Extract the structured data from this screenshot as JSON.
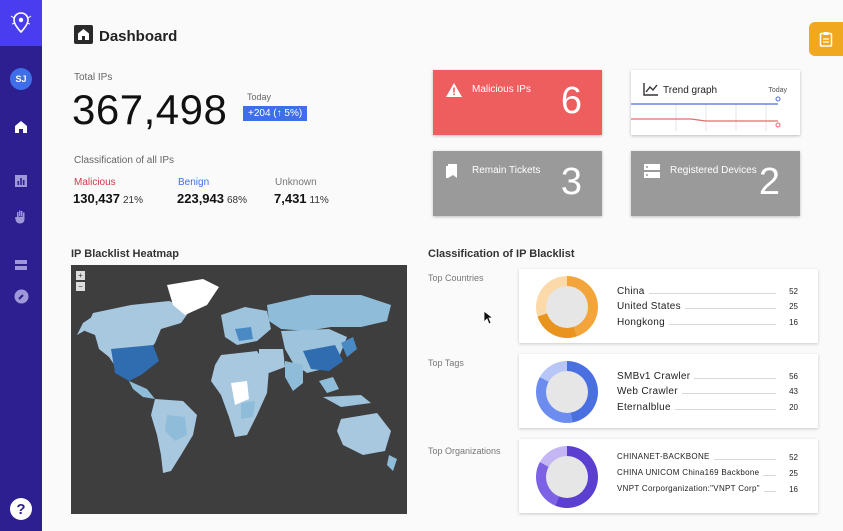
{
  "header": {
    "title": "Dashboard"
  },
  "user": {
    "initials": "SJ"
  },
  "total": {
    "label": "Total IPs",
    "value": "367,498",
    "today_label": "Today",
    "delta": "+204 (↑ 5%)"
  },
  "classification": {
    "title": "Classification of all IPs",
    "items": [
      {
        "name": "Malicious",
        "value": "130,437",
        "pct": "21%",
        "color": "#d9374b"
      },
      {
        "name": "Benign",
        "value": "223,943",
        "pct": "68%",
        "color": "#3f6fe8"
      },
      {
        "name": "Unknown",
        "value": "7,431",
        "pct": "11%",
        "color": "#777777"
      }
    ]
  },
  "cards": {
    "malicious": {
      "label": "Malicious IPs",
      "value": "6"
    },
    "trend": {
      "label": "Trend graph",
      "today": "Today"
    },
    "tickets": {
      "label": "Remain Tickets",
      "value": "3"
    },
    "devices": {
      "label": "Registered Devices",
      "value": "2"
    }
  },
  "heatmap": {
    "title": "IP Blacklist Heatmap",
    "zoom_in": "+",
    "zoom_out": "−"
  },
  "blacklist": {
    "title": "Classification of IP Blacklist",
    "countries": {
      "label": "Top Countries",
      "rows": [
        {
          "name": "China",
          "value": "52"
        },
        {
          "name": "United States",
          "value": "25"
        },
        {
          "name": "Hongkong",
          "value": "16"
        }
      ]
    },
    "tags": {
      "label": "Top Tags",
      "rows": [
        {
          "name": "SMBv1 Crawler",
          "value": "56"
        },
        {
          "name": "Web Crawler",
          "value": "43"
        },
        {
          "name": "Eternalblue",
          "value": "20"
        }
      ]
    },
    "orgs": {
      "label": "Top Organizations",
      "rows": [
        {
          "name": "CHINANET-BACKBONE",
          "value": "52"
        },
        {
          "name": "CHINA UNICOM China169 Backbone",
          "value": "25"
        },
        {
          "name": "VNPT Corporganization:\"VNPT Corp\"",
          "value": "16"
        }
      ]
    }
  },
  "colors": {
    "sidebar": "#2d1f8f",
    "accent": "#3f6fe8",
    "danger": "#ef5e5e",
    "warning": "#f0a81e"
  }
}
